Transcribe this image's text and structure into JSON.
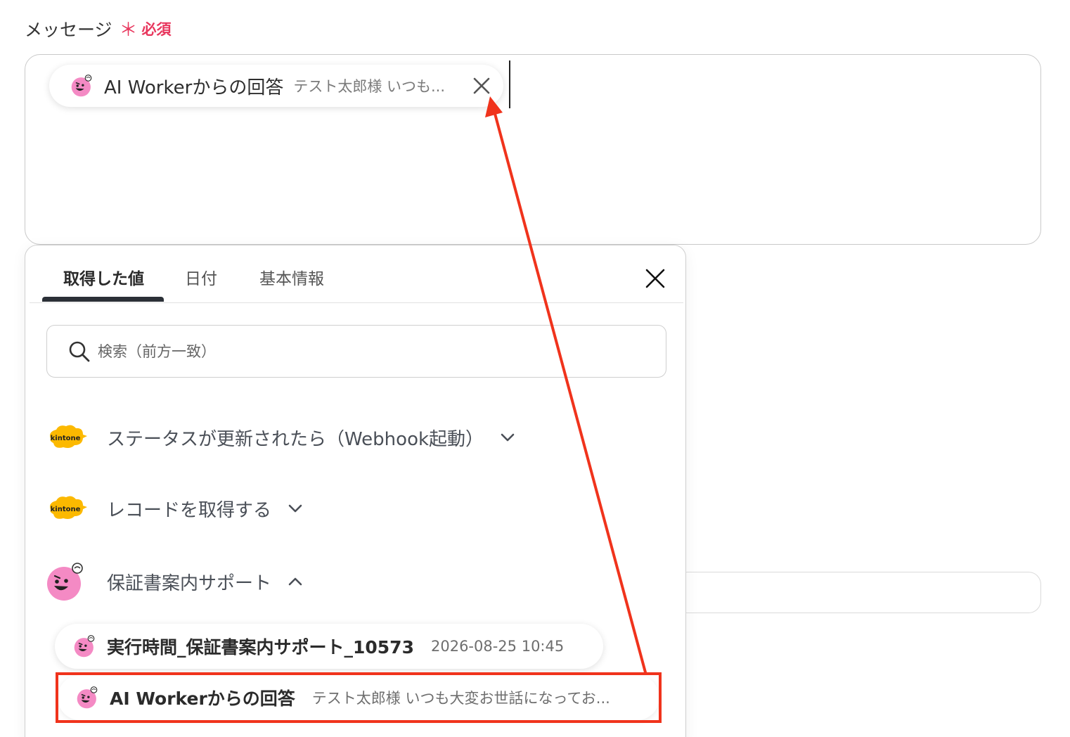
{
  "field": {
    "label": "メッセージ",
    "required_star": "＊",
    "required_text": "必須"
  },
  "token": {
    "title": "AI Workerからの回答",
    "preview": "テスト太郎様 いつも..."
  },
  "panel": {
    "tabs": [
      {
        "label": "取得した値",
        "active": true
      },
      {
        "label": "日付",
        "active": false
      },
      {
        "label": "基本情報",
        "active": false
      }
    ],
    "search_placeholder": "検索（前方一致）",
    "sources": [
      {
        "label": "ステータスが更新されたら（Webhook起動）",
        "icon": "kintone-logo",
        "logo_text": "kintone",
        "expanded": false
      },
      {
        "label": "レコードを取得する",
        "icon": "kintone-logo",
        "logo_text": "kintone",
        "expanded": false
      },
      {
        "label": "保証書案内サポート",
        "icon": "ai-worker-icon",
        "expanded": true
      }
    ],
    "items": [
      {
        "title": "実行時間_保証書案内サポート_10573",
        "sub": "2026-08-25 10:45"
      },
      {
        "title": "AI Workerからの回答",
        "sub": "テスト太郎様 いつも大変お世話になってお..."
      }
    ]
  },
  "colors": {
    "required": "#e8365d",
    "highlight": "#f0331c",
    "kintone": "#fcb900",
    "ai_worker": "#f48ac4"
  }
}
